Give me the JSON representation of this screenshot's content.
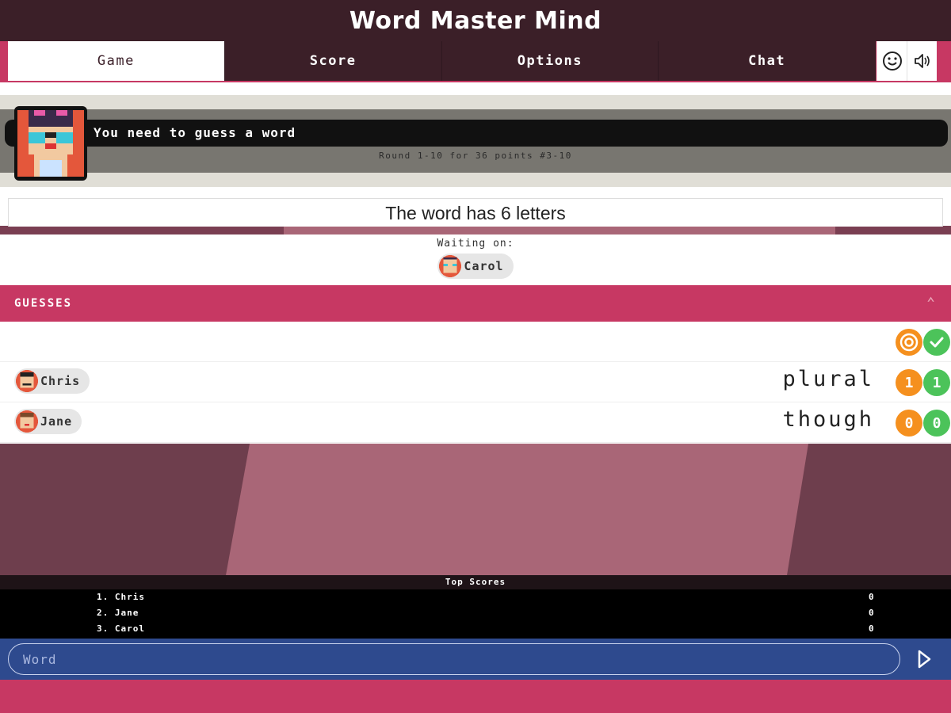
{
  "app": {
    "title": "Word Master Mind"
  },
  "tabs": [
    {
      "label": "Game",
      "active": true
    },
    {
      "label": "Score",
      "active": false
    },
    {
      "label": "Options",
      "active": false
    },
    {
      "label": "Chat",
      "active": false
    }
  ],
  "toolbar_icons": [
    "smiley-icon",
    "speaker-icon"
  ],
  "banner": {
    "message": "You need to guess a word",
    "round_info": "Round 1-10 for 36 points #3-10"
  },
  "word_hint": "The word has 6 letters",
  "waiting": {
    "label": "Waiting on:",
    "player": "Carol"
  },
  "guesses": {
    "header": "GUESSES",
    "legend": {
      "orange_icon": "target-icon",
      "green_icon": "check-icon"
    },
    "rows": [
      {
        "player": "Chris",
        "word": "plural",
        "orange": "1",
        "green": "1"
      },
      {
        "player": "Jane",
        "word": "though",
        "orange": "0",
        "green": "0"
      }
    ]
  },
  "top_scores": {
    "title": "Top Scores",
    "rows": [
      {
        "name": "1. Chris",
        "score": "0"
      },
      {
        "name": "2. Jane",
        "score": "0"
      },
      {
        "name": "3. Carol",
        "score": "0"
      }
    ]
  },
  "input": {
    "placeholder": "Word",
    "value": ""
  },
  "colors": {
    "accent": "#c73863",
    "dark": "#3b1f28",
    "input_bar": "#2e4a8e",
    "orange": "#f5901e",
    "green": "#4cc35a"
  }
}
